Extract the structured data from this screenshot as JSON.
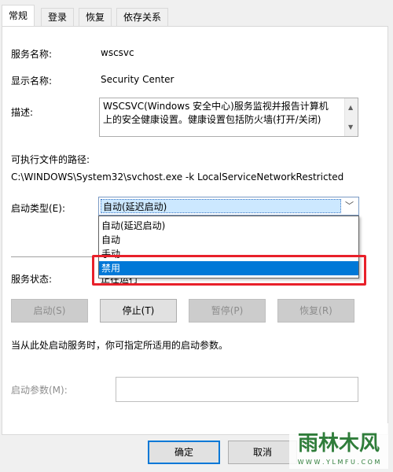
{
  "tabs": [
    {
      "label": "常规",
      "active": true
    },
    {
      "label": "登录",
      "active": false
    },
    {
      "label": "恢复",
      "active": false
    },
    {
      "label": "依存关系",
      "active": false
    }
  ],
  "general": {
    "service_name_label": "服务名称:",
    "service_name_value": "wscsvc",
    "display_name_label": "显示名称:",
    "display_name_value": "Security Center",
    "description_label": "描述:",
    "description_line1": "WSCSVC(Windows 安全中心)服务监视并报告计算机",
    "description_line2": "上的安全健康设置。健康设置包括防火墙(打开/关闭)",
    "exe_path_label": "可执行文件的路径:",
    "exe_path_value": "C:\\WINDOWS\\System32\\svchost.exe -k LocalServiceNetworkRestricted",
    "startup_type_label": "启动类型(E):",
    "startup_type_selected": "自动(延迟启动)",
    "startup_type_options": [
      "自动(延迟启动)",
      "自动",
      "手动",
      "禁用"
    ],
    "highlighted_option": "禁用",
    "service_status_label": "服务状态:",
    "service_status_value": "正在运行",
    "buttons": {
      "start": "启动(S)",
      "stop": "停止(T)",
      "pause": "暂停(P)",
      "resume": "恢复(R)"
    },
    "hint_text": "当从此处启动服务时，你可指定所适用的启动参数。",
    "start_params_label": "启动参数(M):",
    "start_params_value": ""
  },
  "footer": {
    "ok": "确定",
    "cancel": "取消"
  },
  "watermark": {
    "brand": "雨林木风",
    "url": "W W W . Y L M F U . C O M"
  },
  "colors": {
    "highlight": "#0078d7",
    "red_frame": "#e8202a",
    "selection_bg": "#cce8ff"
  }
}
